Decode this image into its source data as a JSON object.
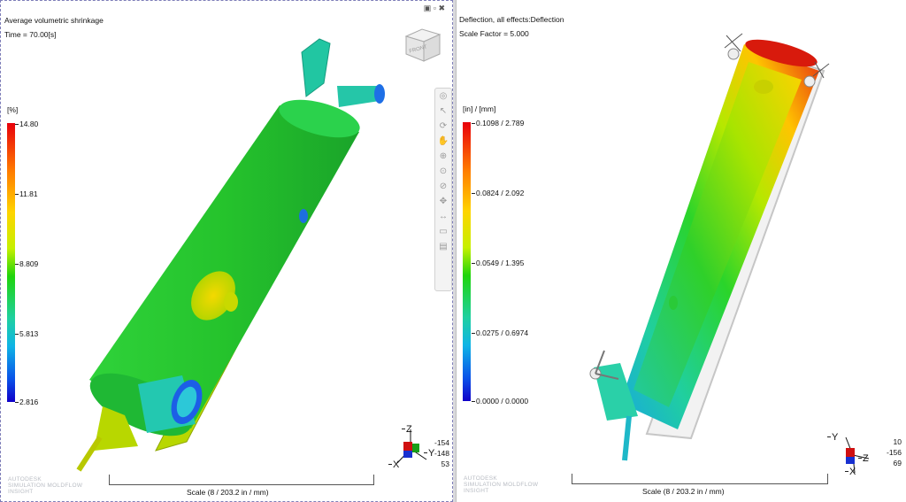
{
  "left_view": {
    "title": "Average volumetric shrinkage",
    "subtitle": "Time = 70.00[s]",
    "legend_unit": "[%]",
    "legend_ticks": [
      "14.80",
      "11.81",
      "8.809",
      "5.813",
      "2.816"
    ],
    "scale_label": "Scale (8 / 203.2 in / mm)",
    "watermark": [
      "AUTODESK",
      "SIMULATION MOLDFLOW",
      "INSIGHT"
    ],
    "coords": [
      "-154",
      "-148",
      "53"
    ],
    "axis_labels": {
      "z": "Z",
      "y": "Y",
      "x": "X"
    },
    "window_icons": "▣ ▫ ✖"
  },
  "right_view": {
    "title": "Deflection, all effects:Deflection",
    "subtitle": "Scale Factor = 5.000",
    "legend_unit": "[in] / [mm]",
    "legend_ticks": [
      "0.1098 / 2.789",
      "0.0824 / 2.092",
      "0.0549 / 1.395",
      "0.0275 / 0.6974",
      "0.0000 /  0.0000"
    ],
    "scale_label": "Scale (8 / 203.2 in / mm)",
    "watermark": [
      "AUTODESK",
      "SIMULATION MOLDFLOW",
      "INSIGHT"
    ],
    "coords": [
      "10",
      "-156",
      "69"
    ],
    "axis_labels": {
      "y": "Y",
      "z": "Z",
      "x": "X"
    }
  },
  "viewcube_label": "FRONT",
  "toolbar_icons": [
    "orbit-wheel-icon",
    "select-arrow-icon",
    "rotate-icon",
    "pan-hand-icon",
    "zoom-icon",
    "zoom-window-icon",
    "zoom-region-icon",
    "move-icon",
    "measure-icon",
    "clip-plane-icon",
    "print-icon"
  ]
}
